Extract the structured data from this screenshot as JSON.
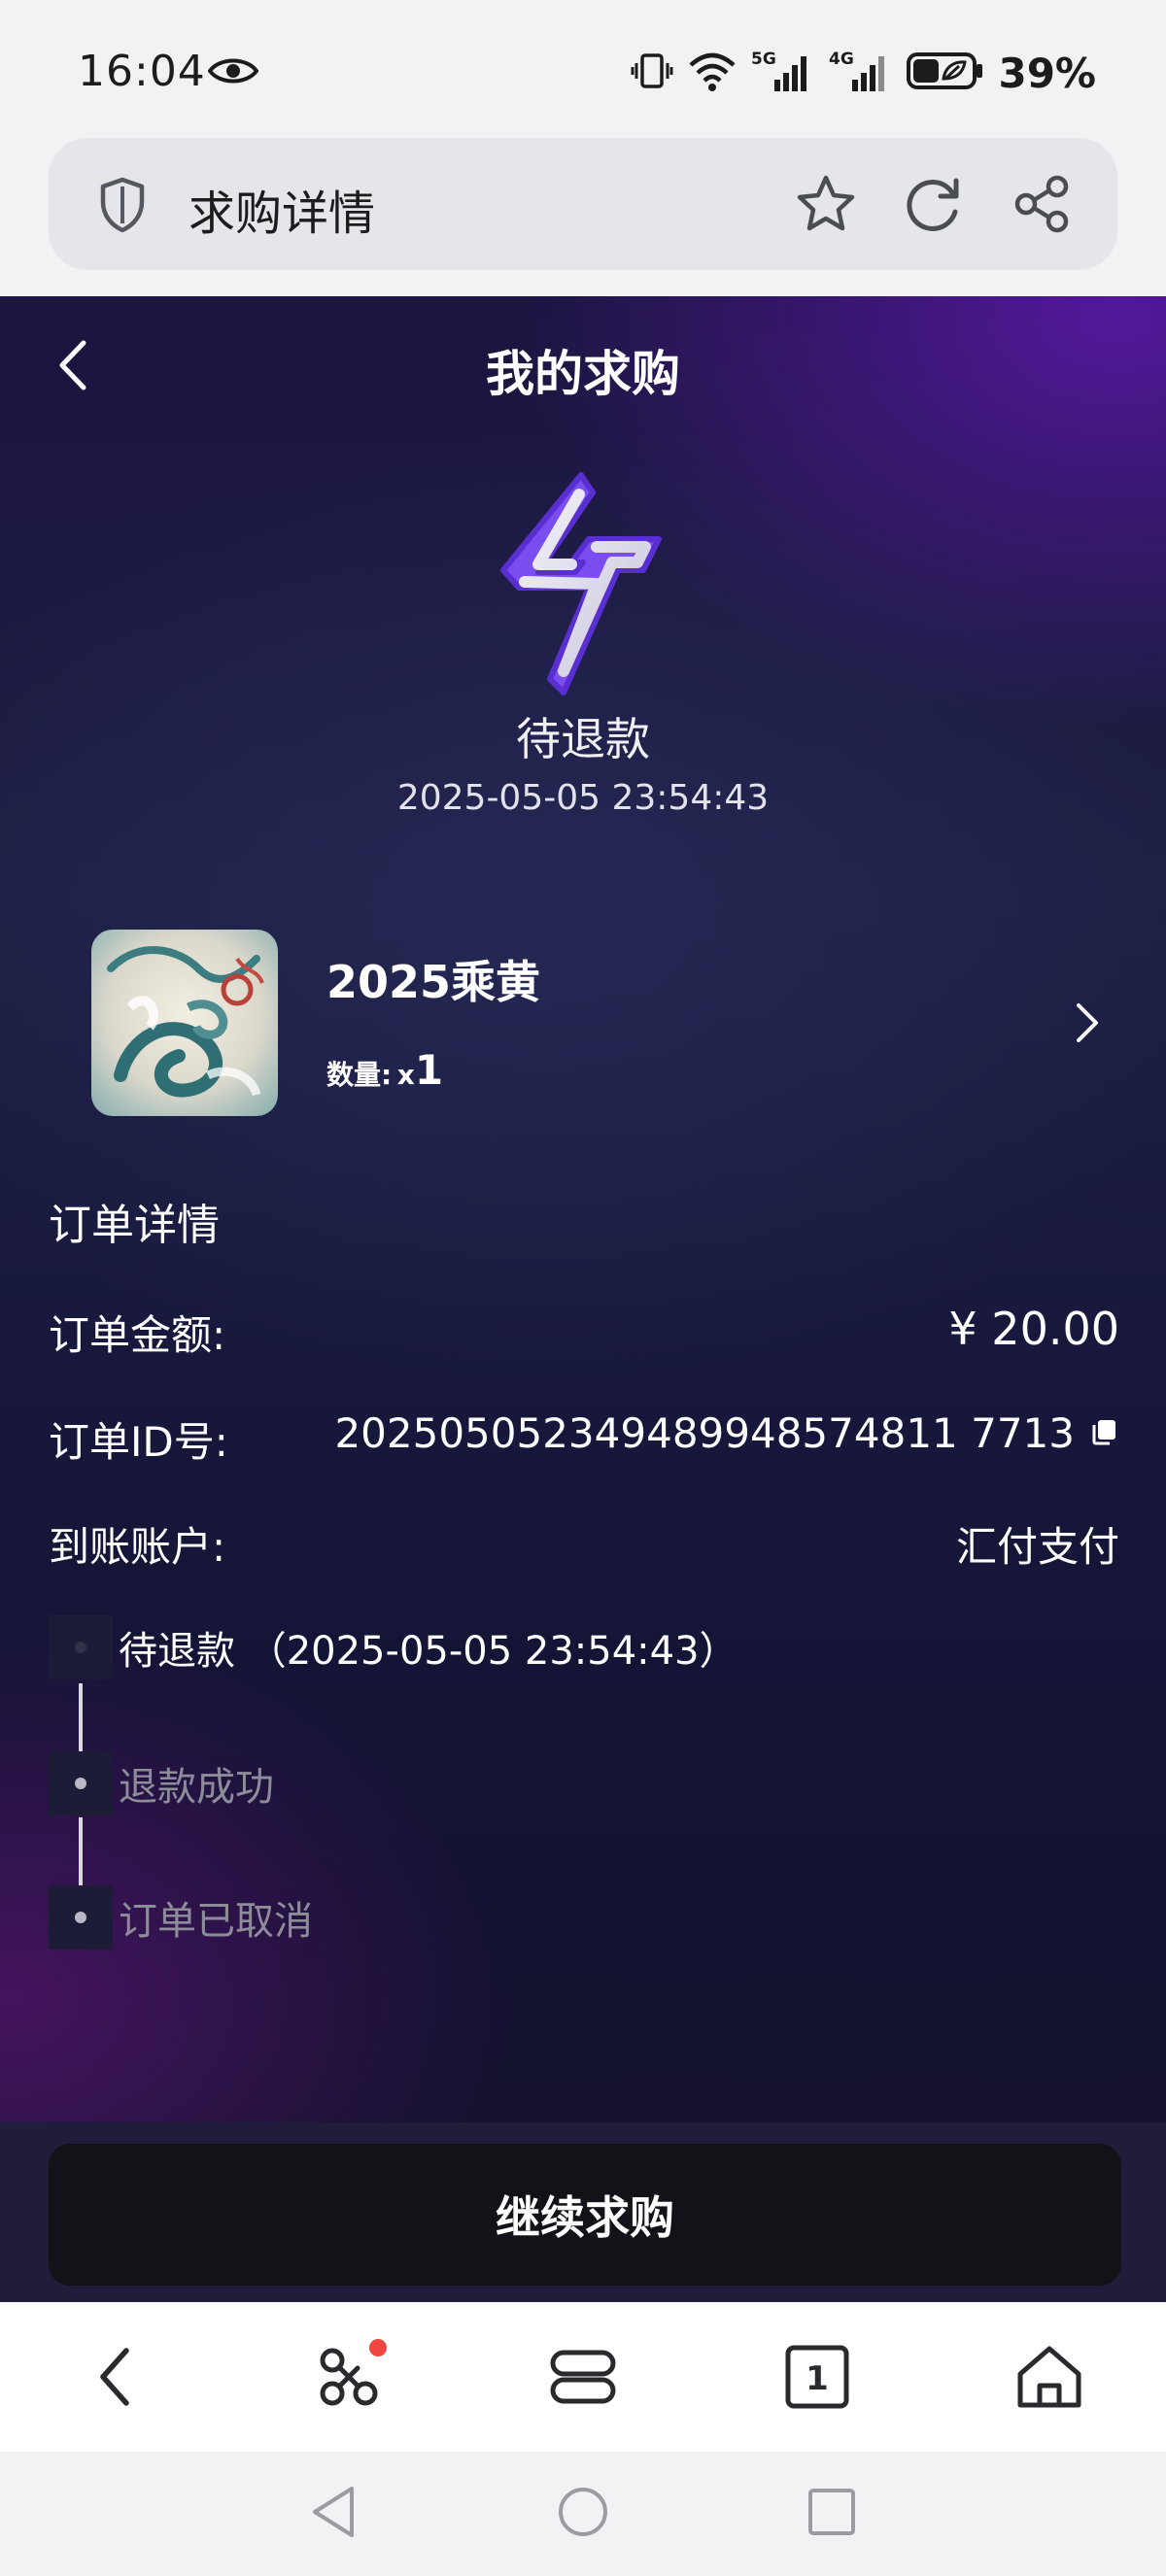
{
  "status_bar": {
    "time": "16:04",
    "battery": "39%",
    "icons": [
      "eye-icon",
      "vibrate-icon",
      "wifi-icon",
      "signal-5g-icon",
      "signal-4g-icon",
      "battery-saver-icon"
    ]
  },
  "browser": {
    "page_title": "求购详情",
    "icons": [
      "shield-icon",
      "star-icon",
      "reload-icon",
      "share-icon"
    ]
  },
  "header": {
    "title": "我的求购"
  },
  "order_status": {
    "label": "待退款",
    "time": "2025-05-05 23:54:43"
  },
  "product": {
    "name": "2025乘黄",
    "qty_label": "数量:",
    "qty_prefix": "x",
    "qty_value": "1"
  },
  "details": {
    "section_title": "订单详情",
    "amount_label": "订单金额:",
    "amount_value": "¥ 20.00",
    "id_label": "订单ID号:",
    "id_value": "202505052349489948574811 7713",
    "account_label": "到账账户:",
    "account_value": "汇付支付"
  },
  "timeline": [
    {
      "text": "待退款 （2025-05-05 23:54:43）",
      "active": true
    },
    {
      "text": "退款成功",
      "active": false
    },
    {
      "text": "订单已取消",
      "active": false
    }
  ],
  "cta": {
    "label": "继续求购"
  },
  "colors": {
    "accent_purple": "#7b4cf0",
    "notification_red": "#f0453f"
  }
}
